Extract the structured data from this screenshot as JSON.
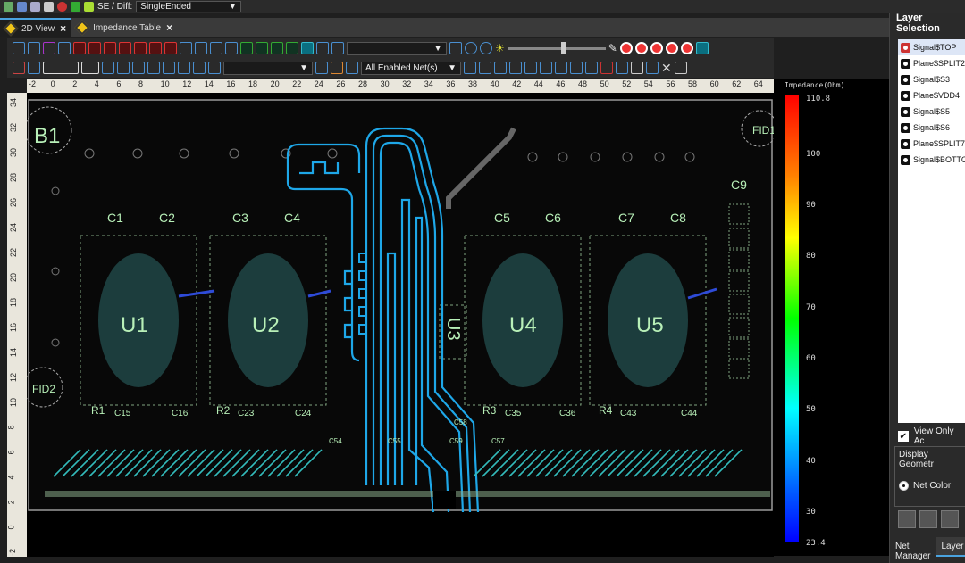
{
  "toolbar_top": {
    "se_diff_label": "SE / Diff:",
    "se_diff_value": "SingleEnded"
  },
  "tabs": [
    {
      "label": "2D View"
    },
    {
      "label": "Impedance Table"
    }
  ],
  "toolbar": {
    "net_filter": "All Enabled Net(s)"
  },
  "ruler_h": [
    "-2",
    "0",
    "2",
    "4",
    "6",
    "8",
    "10",
    "12",
    "14",
    "16",
    "18",
    "20",
    "22",
    "24",
    "26",
    "28",
    "30",
    "32",
    "34",
    "36",
    "38",
    "40",
    "42",
    "44",
    "46",
    "48",
    "50",
    "52",
    "54",
    "56",
    "58",
    "60",
    "62",
    "64"
  ],
  "ruler_v": [
    "34",
    "32",
    "30",
    "28",
    "26",
    "24",
    "22",
    "20",
    "18",
    "16",
    "14",
    "12",
    "10",
    "8",
    "6",
    "4",
    "2",
    "0",
    "-2"
  ],
  "board": {
    "labels": {
      "b1": "B1",
      "fid1": "FID1",
      "fid2": "FID2",
      "u1": "U1",
      "u2": "U2",
      "u3": "U3",
      "u4": "U4",
      "u5": "U5",
      "c1": "C1",
      "c2": "C2",
      "c3": "C3",
      "c4": "C4",
      "c5": "C5",
      "c6": "C6",
      "c7": "C7",
      "c8": "C8",
      "c9": "C9",
      "r1": "R1",
      "r2": "R2",
      "r3": "R3",
      "r4": "R4",
      "c15": "C15",
      "c16": "C16",
      "c23": "C23",
      "c24": "C24",
      "c35": "C35",
      "c36": "C36",
      "c43": "C43",
      "c44": "C44",
      "c54": "C54",
      "c55": "C55",
      "c57": "C57",
      "c59": "C59",
      "c58": "C58"
    }
  },
  "impedance_scale": {
    "title": "Impedance(Ohm)",
    "max": "110.8",
    "min": "23.4",
    "ticks": [
      "100",
      "90",
      "80",
      "70",
      "60",
      "50",
      "40",
      "30"
    ]
  },
  "layer_panel": {
    "title": "Layer Selection",
    "layers": [
      "Signal$TOP",
      "Plane$SPLIT2",
      "Signal$S3",
      "Plane$VDD4",
      "Signal$S5",
      "Signal$S6",
      "Plane$SPLIT7",
      "Signal$BOTTOM"
    ],
    "view_only_label": "View Only Ac",
    "display_geometry_label": "Display Geometr",
    "net_color_label": "Net Color",
    "bottom_tabs": [
      "Net Manager",
      "Layer"
    ]
  },
  "colors": {
    "trace": "#1ea7e8",
    "via": "#3f8f8f",
    "outline": "#9a9a9a",
    "label": "#b8f0b8",
    "accent": "#4aa3df"
  }
}
